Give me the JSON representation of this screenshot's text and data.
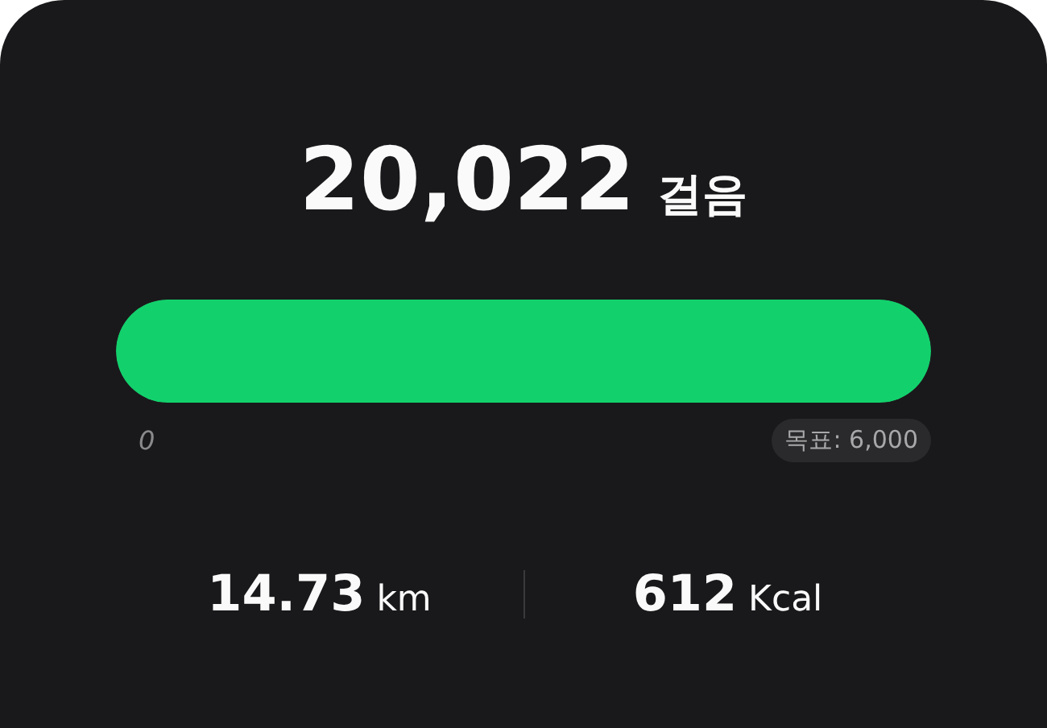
{
  "steps": {
    "value": "20,022",
    "unit": "걸음"
  },
  "progress": {
    "level": 1,
    "start_label": "0",
    "goal_label": "목표: 6,000"
  },
  "stats": [
    {
      "value": "14.73",
      "unit": "km"
    },
    {
      "value": "612",
      "unit": "Kcal"
    }
  ]
}
